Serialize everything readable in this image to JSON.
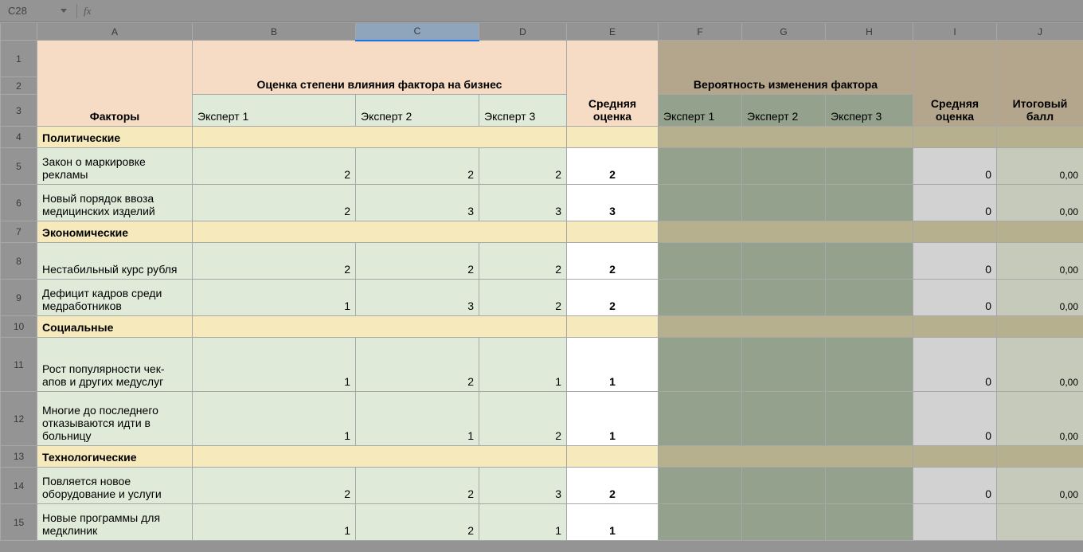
{
  "formula_bar": {
    "cell_ref": "C28",
    "fx": "fx",
    "value": ""
  },
  "columns": [
    "A",
    "B",
    "C",
    "D",
    "E",
    "F",
    "G",
    "H",
    "I",
    "J"
  ],
  "row_numbers": [
    1,
    2,
    3,
    4,
    5,
    6,
    7,
    8,
    9,
    10,
    11,
    12,
    13,
    14,
    15
  ],
  "selected_column": "C",
  "headers": {
    "factors": "Факторы",
    "influence": "Оценка степени влияния фактора на бизнес",
    "avg1": "Средняя оценка",
    "probability": "Вероятность изменения фактора",
    "avg2": "Средняя оценка",
    "total": "Итоговый балл",
    "exp1": "Эксперт 1",
    "exp2": "Эксперт 2",
    "exp3": "Эксперт 3",
    "exp1b": "Эксперт 1",
    "exp2b": "Эксперт 2",
    "exp3b": "Эксперт 3"
  },
  "sections": {
    "political": "Политические",
    "economic": "Экономические",
    "social": "Социальные",
    "tech": "Технологические"
  },
  "rows": {
    "r5": {
      "label": "Закон о маркировке рекламы",
      "b": "2",
      "c": "2",
      "d": "2",
      "e": "2",
      "i": "0",
      "j": "0,00"
    },
    "r6": {
      "label": "Новый порядок ввоза медицинских изделий",
      "b": "2",
      "c": "3",
      "d": "3",
      "e": "3",
      "i": "0",
      "j": "0,00"
    },
    "r8": {
      "label": "Нестабильный курс рубля",
      "b": "2",
      "c": "2",
      "d": "2",
      "e": "2",
      "i": "0",
      "j": "0,00"
    },
    "r9": {
      "label": "Дефицит кадров среди медработников",
      "b": "1",
      "c": "3",
      "d": "2",
      "e": "2",
      "i": "0",
      "j": "0,00"
    },
    "r11": {
      "label": "Рост популярности чек-апов и других медуслуг",
      "b": "1",
      "c": "2",
      "d": "1",
      "e": "1",
      "i": "0",
      "j": "0,00"
    },
    "r12": {
      "label": "Многие до последнего отказываются идти в больницу",
      "b": "1",
      "c": "1",
      "d": "2",
      "e": "1",
      "i": "0",
      "j": "0,00"
    },
    "r14": {
      "label": "Повляется новое оборудование и услуги",
      "b": "2",
      "c": "2",
      "d": "3",
      "e": "2",
      "i": "0",
      "j": "0,00"
    },
    "r15": {
      "label": "Новые программы для медклиник",
      "b": "1",
      "c": "2",
      "d": "1",
      "e": "1",
      "i": "",
      "j": ""
    }
  }
}
